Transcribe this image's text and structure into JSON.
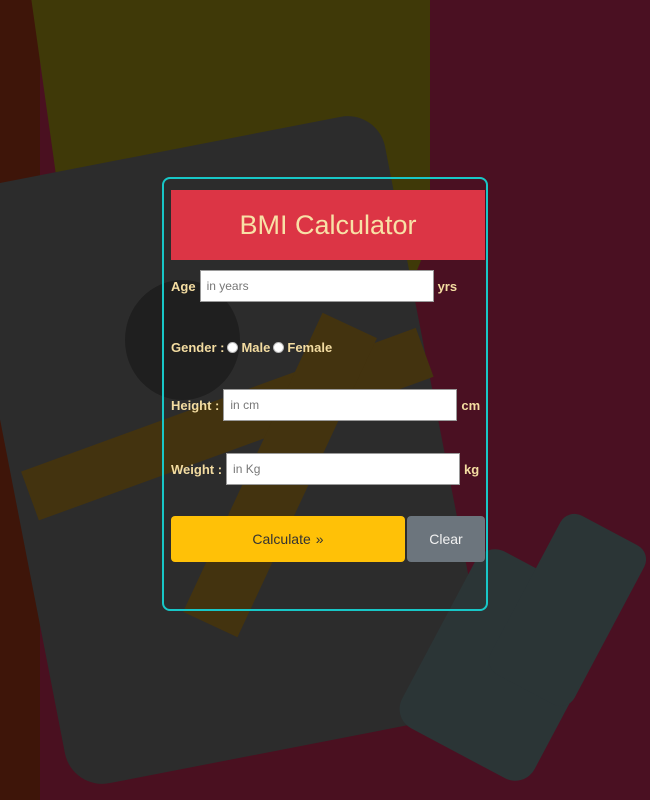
{
  "header": {
    "title": "BMI Calculator"
  },
  "fields": {
    "age": {
      "label": "Age",
      "placeholder": "in years",
      "value": "",
      "unit": "yrs"
    },
    "gender": {
      "label": "Gender :",
      "options": [
        "Male",
        "Female"
      ]
    },
    "height": {
      "label": "Height :",
      "placeholder": "in cm",
      "value": "",
      "unit": "cm"
    },
    "weight": {
      "label": "Weight :",
      "placeholder": "in Kg",
      "value": "",
      "unit": "kg"
    }
  },
  "buttons": {
    "calculate": "Calculate",
    "calculate_icon": "»",
    "clear": "Clear"
  },
  "colors": {
    "title_bar": "#dc3545",
    "title_text": "#f8e1a6",
    "card_border": "#18c7c7",
    "calculate_button": "#ffc107",
    "clear_button": "#6c757d",
    "label_text": "#f3dca1"
  }
}
